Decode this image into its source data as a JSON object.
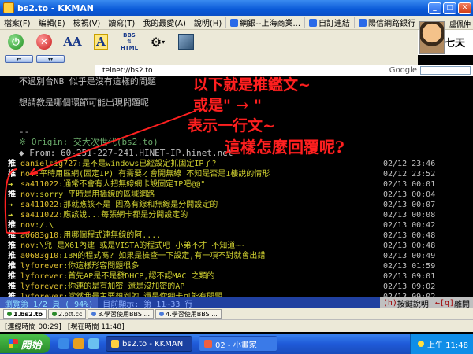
{
  "window": {
    "title": "bs2.to - KKMAN"
  },
  "menu": {
    "items": [
      "檔案(F)",
      "編輯(E)",
      "檢視(V)",
      "讀寫(T)",
      "我的最愛(A)",
      "說明(H)"
    ],
    "favorites": [
      "網銀--上海商業...",
      "自訂連結",
      "陽信網路銀行"
    ]
  },
  "user": {
    "name": "盧佩仲",
    "logo": "七天"
  },
  "address": {
    "url": "telnet://bs2.to",
    "search_label": "Google",
    "search_placeholder": ""
  },
  "terminal": {
    "top_lines": [
      "不過別台NB 似乎是沒有這樣的問題",
      "想請教是哪個環節可能出現問題呢"
    ],
    "dashes": "--",
    "origin": "※ Origin: 交大次世代(bs2.to)",
    "from": "◆ From: 60-251-227-241.HINET-IP.hinet.net",
    "pushes": [
      {
        "tag": "推",
        "user": "danielsig727",
        "msg": ":是不是windows已經設定抓固定IP了?",
        "time": "02/12 23:46"
      },
      {
        "tag": "推",
        "user": "nov",
        "msg": ":平時用區網(固定IP) 有需要才會開無線   不知是否是1樓說的情形",
        "time": "02/12 23:52"
      },
      {
        "tag": "→",
        "user": "sa411022",
        "msg": ":通常不會有人把無線網卡設固定IP吧@@\"",
        "time": "02/13 00:01"
      },
      {
        "tag": "推",
        "user": "nov",
        "msg": ":sorry 平時是用插線的區域網路",
        "time": "02/13 00:04"
      },
      {
        "tag": "→",
        "user": "sa411022",
        "msg": ":那就應該不是   因為有線和無線是分開設定的",
        "time": "02/13 00:07"
      },
      {
        "tag": "→",
        "user": "sa411022",
        "msg": ":應該說...每張網卡都是分開設定的",
        "time": "02/13 00:08"
      },
      {
        "tag": "推",
        "user": "nov",
        "msg": ":/.\\",
        "time": "02/13 00:42"
      },
      {
        "tag": "推",
        "user": "a0683g10",
        "msg": ":用哪個程式連無線的阿....",
        "time": "02/13 00:48"
      },
      {
        "tag": "推",
        "user": "nov",
        "msg": ":\\兜  是X61內建  或是VISTA的程式吧   小弟不才 不知道~~",
        "time": "02/13 00:48"
      },
      {
        "tag": "推",
        "user": "a0683g10",
        "msg": ":IBM的程式嗎?  如果是檢查一下設定,有一項不對就會出錯",
        "time": "02/13 00:49"
      },
      {
        "tag": "推",
        "user": "lyforever",
        "msg": ":你這樣形容問題很多",
        "time": "02/13 01:59"
      },
      {
        "tag": "推",
        "user": "lyforever",
        "msg": ":首先AP是不是發DHCP,認不認MAC 之類的",
        "time": "02/13 09:01"
      },
      {
        "tag": "推",
        "user": "lyforever",
        "msg": ":你連的是有加密   還是沒加密的AP",
        "time": "02/13 09:02"
      },
      {
        "tag": "推",
        "user": "lyforever",
        "msg": ":當然我最主要想到的   還是你網卡可能有問題",
        "time": "02/13 09:02"
      }
    ],
    "annotation": {
      "line1": "以下就是推鑑文~",
      "line2": "或是\"  → \"",
      "line3": "表示一行文~",
      "line4": "這樣怎麼回覆呢?"
    },
    "status": {
      "browse": "瀏覽第  1/2 頁 ( 94%)",
      "range": "目前顯示: 第 11~33 行",
      "help_key": "(h)",
      "help_label": "按鍵說明",
      "leave_key": "←[q]",
      "leave_label": "離開"
    }
  },
  "conn_tabs": [
    "1.bs2.to",
    "2.ptt.cc",
    "3.學習使用BBS ...",
    "4.學習使用BBS ..."
  ],
  "app_status": {
    "connect_time": "[連線時間 00:29]",
    "now_time": "[現在時間 11:48]"
  },
  "taskbar": {
    "start": "開始",
    "tasks": [
      "bs2.to - KKMAN",
      "02 - 小畫家"
    ],
    "clock": "上午 11:48"
  },
  "colors": {
    "terminal_bg": "#000000",
    "annotation": "#ff2020",
    "push_message": "#d0d030"
  }
}
